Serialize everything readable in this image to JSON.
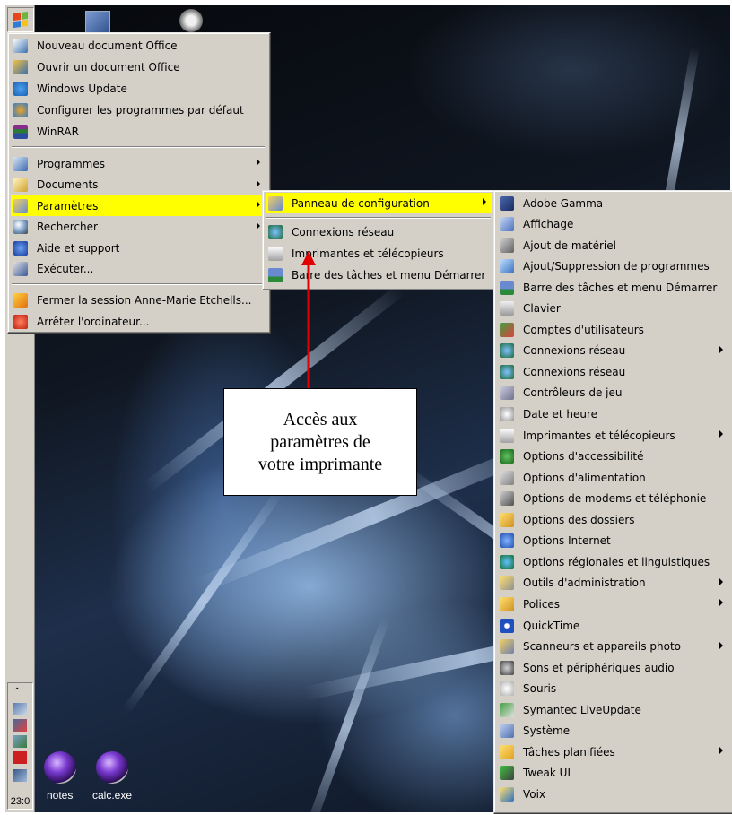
{
  "desktop": {
    "icons": [
      {
        "label": "notes",
        "icon": "purple-disc-icon"
      },
      {
        "label": "calc.exe",
        "icon": "purple-disc-icon"
      }
    ]
  },
  "taskbar": {
    "clock": "23:0",
    "tray_chevron": "⌃"
  },
  "start_menu": {
    "pinned": [
      {
        "label": "Nouveau document Office",
        "icon": "new-office-doc-icon"
      },
      {
        "label": "Ouvrir un document Office",
        "icon": "open-office-doc-icon"
      },
      {
        "label": "Windows Update",
        "icon": "windows-update-icon"
      },
      {
        "label": "Configurer les programmes par défaut",
        "icon": "default-programs-icon"
      },
      {
        "label": "WinRAR",
        "icon": "winrar-icon"
      }
    ],
    "main": [
      {
        "label": "Programmes",
        "icon": "programs-icon",
        "submenu": true
      },
      {
        "label": "Documents",
        "icon": "documents-icon",
        "submenu": true
      },
      {
        "label": "Paramètres",
        "icon": "settings-icon",
        "submenu": true,
        "selected": true
      },
      {
        "label": "Rechercher",
        "icon": "search-icon",
        "submenu": true
      },
      {
        "label": "Aide et support",
        "icon": "help-icon"
      },
      {
        "label": "Exécuter...",
        "icon": "run-icon"
      }
    ],
    "session": [
      {
        "label": "Fermer la session Anne-Marie Etchells...",
        "icon": "logoff-icon"
      },
      {
        "label": "Arrêter l'ordinateur...",
        "icon": "shutdown-icon"
      }
    ]
  },
  "settings_menu": {
    "items": [
      {
        "label": "Panneau de configuration",
        "icon": "control-panel-icon",
        "submenu": true,
        "selected": true
      },
      {
        "label": "Connexions réseau",
        "icon": "network-icon"
      },
      {
        "label": "Imprimantes et télécopieurs",
        "icon": "printer-icon"
      },
      {
        "label": "Barre des tâches et menu Démarrer",
        "icon": "taskbar-icon"
      }
    ]
  },
  "control_panel_menu": {
    "items": [
      {
        "label": "Adobe Gamma",
        "icon": "monitor-icon"
      },
      {
        "label": "Affichage",
        "icon": "display-icon"
      },
      {
        "label": "Ajout de matériel",
        "icon": "hardware-icon"
      },
      {
        "label": "Ajout/Suppression de programmes",
        "icon": "add-remove-icon"
      },
      {
        "label": "Barre des tâches et menu Démarrer",
        "icon": "taskbar-icon"
      },
      {
        "label": "Clavier",
        "icon": "keyboard-icon"
      },
      {
        "label": "Comptes d'utilisateurs",
        "icon": "users-icon"
      },
      {
        "label": "Connexions réseau",
        "icon": "network-icon",
        "submenu": true
      },
      {
        "label": "Connexions réseau",
        "icon": "network-icon"
      },
      {
        "label": "Contrôleurs de jeu",
        "icon": "joystick-icon"
      },
      {
        "label": "Date et heure",
        "icon": "clock-icon"
      },
      {
        "label": "Imprimantes et télécopieurs",
        "icon": "printer-icon",
        "submenu": true
      },
      {
        "label": "Options d'accessibilité",
        "icon": "accessibility-icon"
      },
      {
        "label": "Options d'alimentation",
        "icon": "power-icon"
      },
      {
        "label": "Options de modems et téléphonie",
        "icon": "phone-icon"
      },
      {
        "label": "Options des dossiers",
        "icon": "folder-options-icon"
      },
      {
        "label": "Options Internet",
        "icon": "internet-icon"
      },
      {
        "label": "Options régionales et linguistiques",
        "icon": "globe-icon"
      },
      {
        "label": "Outils d'administration",
        "icon": "admin-tools-icon",
        "submenu": true
      },
      {
        "label": "Polices",
        "icon": "fonts-folder-icon",
        "submenu": true
      },
      {
        "label": "QuickTime",
        "icon": "quicktime-icon"
      },
      {
        "label": "Scanneurs et appareils photo",
        "icon": "scanner-icon",
        "submenu": true
      },
      {
        "label": "Sons et périphériques audio",
        "icon": "sound-icon"
      },
      {
        "label": "Souris",
        "icon": "mouse-icon"
      },
      {
        "label": "Symantec LiveUpdate",
        "icon": "liveupdate-icon"
      },
      {
        "label": "Système",
        "icon": "system-icon"
      },
      {
        "label": "Tâches planifiées",
        "icon": "scheduled-tasks-icon",
        "submenu": true
      },
      {
        "label": "Tweak UI",
        "icon": "tweakui-icon"
      },
      {
        "label": "Voix",
        "icon": "speech-icon"
      }
    ]
  },
  "annotation": {
    "text": "Accès aux\nparamètres de\nvotre imprimante"
  },
  "colors": {
    "highlight": "#ffff00",
    "menu_bg": "#d4d0c8",
    "arrow": "#e00000"
  }
}
